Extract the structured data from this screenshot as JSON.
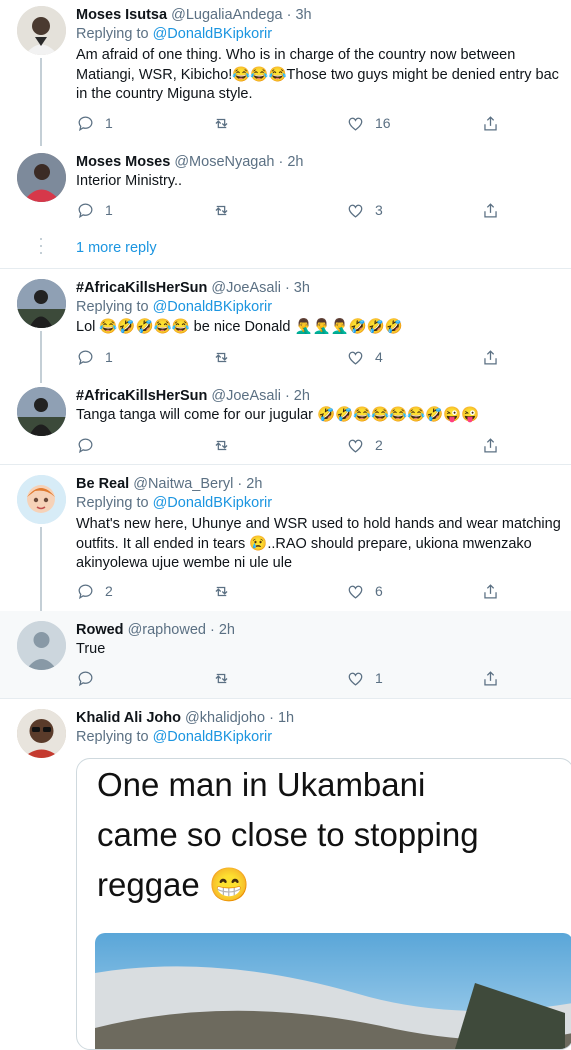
{
  "tweets": [
    {
      "name": "Moses Isutsa",
      "handle": "@LugaliaAndega",
      "time": "· 3h",
      "replying_label": "Replying to",
      "replying_to": "@DonaldBKipkorir",
      "lines": [
        "Am afraid of one thing. Who is in charge of the country now between",
        "Matiangi, WSR, Kibicho!😂😂😂Those two guys might be denied entry bac",
        "in the country Miguna style."
      ],
      "replies": "1",
      "retweets": "",
      "likes": "16"
    },
    {
      "name": "Moses Moses",
      "handle": "@MoseNyagah",
      "time": "· 2h",
      "lines": [
        "Interior Ministry.."
      ],
      "replies": "1",
      "retweets": "",
      "likes": "3"
    },
    {
      "name": "#AfricaKillsHerSun",
      "handle": "@JoeAsali",
      "time": "· 3h",
      "replying_label": "Replying to",
      "replying_to": "@DonaldBKipkorir",
      "lines": [
        "Lol 😂🤣🤣😂😂 be nice Donald 🤦‍♂️🤦‍♂️🤦‍♂️🤣🤣🤣"
      ],
      "replies": "1",
      "retweets": "",
      "likes": "4"
    },
    {
      "name": "#AfricaKillsHerSun",
      "handle": "@JoeAsali",
      "time": "· 2h",
      "lines": [
        "Tanga tanga will come for our jugular 🤣🤣😂😂😂😂🤣😜😜"
      ],
      "replies": "",
      "retweets": "",
      "likes": "2"
    },
    {
      "name": "Be Real",
      "handle": "@Naitwa_Beryl",
      "time": "· 2h",
      "replying_label": "Replying to",
      "replying_to": "@DonaldBKipkorir",
      "lines": [
        "What's new here,  Uhunye and WSR used to hold hands and wear matching",
        "outfits. It all ended in tears 😢..RAO should prepare, ukiona mwenzako",
        "akinyolewa ujue wembe ni ule ule"
      ],
      "replies": "2",
      "retweets": "",
      "likes": "6"
    },
    {
      "name": "Rowed",
      "handle": "@raphowed",
      "time": "· 2h",
      "lines": [
        "True"
      ],
      "replies": "",
      "retweets": "",
      "likes": "1"
    },
    {
      "name": "Khalid Ali Joho",
      "handle": "@khalidjoho",
      "time": "· 1h",
      "replying_label": "Replying to",
      "replying_to": "@DonaldBKipkorir",
      "lines": []
    }
  ],
  "more_reply": "1 more reply",
  "image_text": [
    "One man in Ukambani",
    "came so close to stopping",
    "reggae 😁"
  ],
  "colors": {
    "accent": "#1b95e0",
    "muted": "#5b7083",
    "divider": "#e6ecf0"
  }
}
